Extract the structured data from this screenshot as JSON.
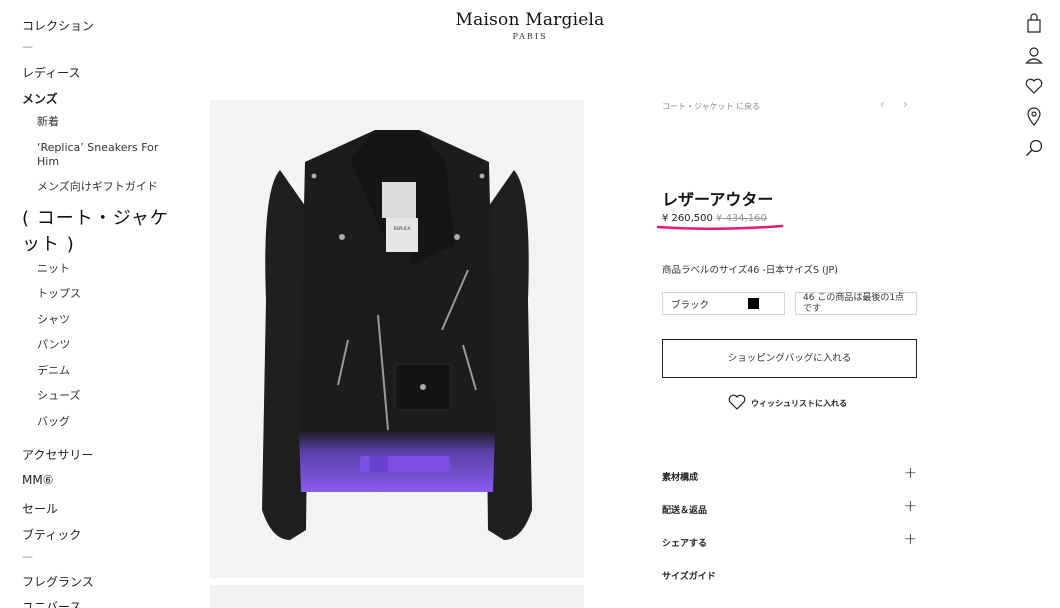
{
  "brand": {
    "name": "Maison Margiela",
    "sub": "PARIS"
  },
  "sidebar": {
    "collection": "コレクション",
    "sep1": "—",
    "ladies": "レディース",
    "mens": "メンズ",
    "mens_items": [
      "新着",
      "‘Replica’ Sneakers For Him",
      "メンズ向けギフトガイド"
    ],
    "current": "( コート・ジャケット )",
    "mens_items2": [
      "ニット",
      "トップス",
      "シャツ",
      "パンツ",
      "デニム",
      "シューズ",
      "バッグ"
    ],
    "accessories": "アクセサリー",
    "mm6": "MM⑥",
    "sale": "セール",
    "boutique": "ブティック",
    "sep2": "—",
    "fragrance": "フレグランス",
    "universe": "ユニバース"
  },
  "utility_icons": [
    "bag-icon",
    "user-icon",
    "heart-icon",
    "location-icon",
    "search-icon"
  ],
  "product": {
    "back_link": "コート・ジャケット に戻る",
    "prev_arrow": "‹",
    "next_arrow": "›",
    "title": "レザーアウター",
    "price": "¥ 260,500",
    "price_old": "¥ 434,160",
    "size_label": "商品ラベルのサイズ46 -日本サイズS (JP)",
    "color_value": "ブラック",
    "size_value": "46 この商品は最後の1点です",
    "add_to_bag": "ショッピングバッグに入れる",
    "wishlist": "ウィッシュリストに入れる",
    "accordions": [
      {
        "label": "素材構成",
        "icon": "+"
      },
      {
        "label": "配送＆返品",
        "icon": "+"
      },
      {
        "label": "シェアする",
        "icon": "+"
      },
      {
        "label": "サイズガイド",
        "icon": ""
      }
    ],
    "label_tag_text": "REPLICA",
    "colors": {
      "jacket": "#1c1c1c",
      "purple": "#8a5cf0",
      "underline": "#e8186d"
    }
  }
}
